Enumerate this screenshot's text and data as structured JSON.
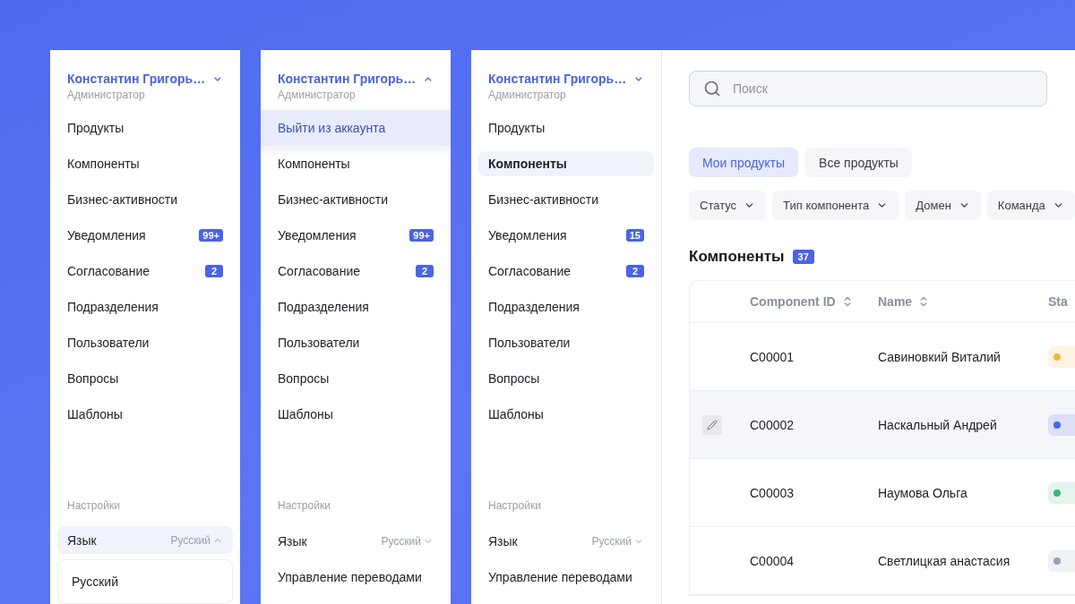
{
  "panels": [
    {
      "user": {
        "name": "Константин Григорь…",
        "role": "Администратор",
        "expanded": false
      },
      "nav": [
        {
          "label": "Продукты",
          "selected": false
        },
        {
          "label": "Компоненты",
          "selected": false
        },
        {
          "label": "Бизнес-активности",
          "selected": false
        },
        {
          "label": "Уведомления",
          "badge": "99+",
          "selected": false
        },
        {
          "label": "Согласование",
          "badge": "2",
          "selected": false
        },
        {
          "label": "Подразделения",
          "selected": false
        },
        {
          "label": "Пользователи",
          "selected": false
        },
        {
          "label": "Вопросы",
          "selected": false
        },
        {
          "label": "Шаблоны",
          "selected": false
        }
      ],
      "settings": {
        "heading": "Настройки",
        "items": [
          {
            "kind": "select",
            "label": "Язык",
            "value": "Русский",
            "expanded": true,
            "options": [
              "Русский"
            ]
          }
        ]
      }
    },
    {
      "user": {
        "name": "Константин Григорь…",
        "role": "Администратор",
        "expanded": true
      },
      "account_menu": [
        {
          "label": "Выйти из аккаунта",
          "hovered": true
        }
      ],
      "nav": [
        {
          "label": "Компоненты",
          "selected": false
        },
        {
          "label": "Бизнес-активности",
          "selected": false
        },
        {
          "label": "Уведомления",
          "badge": "99+",
          "selected": false
        },
        {
          "label": "Согласование",
          "badge": "2",
          "selected": false
        },
        {
          "label": "Подразделения",
          "selected": false
        },
        {
          "label": "Пользователи",
          "selected": false
        },
        {
          "label": "Вопросы",
          "selected": false
        },
        {
          "label": "Шаблоны",
          "selected": false
        }
      ],
      "settings": {
        "heading": "Настройки",
        "items": [
          {
            "kind": "select",
            "label": "Язык",
            "value": "Русский",
            "expanded": false
          },
          {
            "kind": "link",
            "label": "Управление переводами"
          }
        ]
      }
    },
    {
      "user": {
        "name": "Константин Григорь…",
        "role": "Администратор",
        "expanded": false
      },
      "nav": [
        {
          "label": "Продукты",
          "selected": false
        },
        {
          "label": "Компоненты",
          "selected": true
        },
        {
          "label": "Бизнес-активности",
          "selected": false
        },
        {
          "label": "Уведомления",
          "badge": "15",
          "selected": false
        },
        {
          "label": "Согласование",
          "badge": "2",
          "selected": false
        },
        {
          "label": "Подразделения",
          "selected": false
        },
        {
          "label": "Пользователи",
          "selected": false
        },
        {
          "label": "Вопросы",
          "selected": false
        },
        {
          "label": "Шаблоны",
          "selected": false
        }
      ],
      "settings": {
        "heading": "Настройки",
        "items": [
          {
            "kind": "select",
            "label": "Язык",
            "value": "Русский",
            "expanded": false
          },
          {
            "kind": "link",
            "label": "Управление переводами"
          }
        ]
      }
    }
  ],
  "main": {
    "search": {
      "placeholder": "Поиск"
    },
    "tabs": [
      {
        "label": "Мои продукты",
        "selected": true
      },
      {
        "label": "Все продукты",
        "selected": false
      }
    ],
    "filters": [
      "Статус",
      "Тип компонента",
      "Домен",
      "Команда"
    ],
    "section": {
      "title": "Компоненты",
      "count": "37"
    },
    "table": {
      "columns": [
        {
          "label": "Component ID",
          "sortable": true
        },
        {
          "label": "Name",
          "sortable": true
        },
        {
          "label": "Sta"
        }
      ],
      "rows": [
        {
          "id": "C00001",
          "name": "Савиновкий Виталий",
          "color": "#f2b544",
          "hovered": false
        },
        {
          "id": "C00002",
          "name": "Наскальный Андрей",
          "color": "#4a63e8",
          "hovered": true
        },
        {
          "id": "C00003",
          "name": "Наумова Ольга",
          "color": "#3fb37f",
          "hovered": false
        },
        {
          "id": "C00004",
          "name": "Светлицкая анастасия",
          "color": "#9aa0ad",
          "hovered": false
        }
      ]
    }
  }
}
